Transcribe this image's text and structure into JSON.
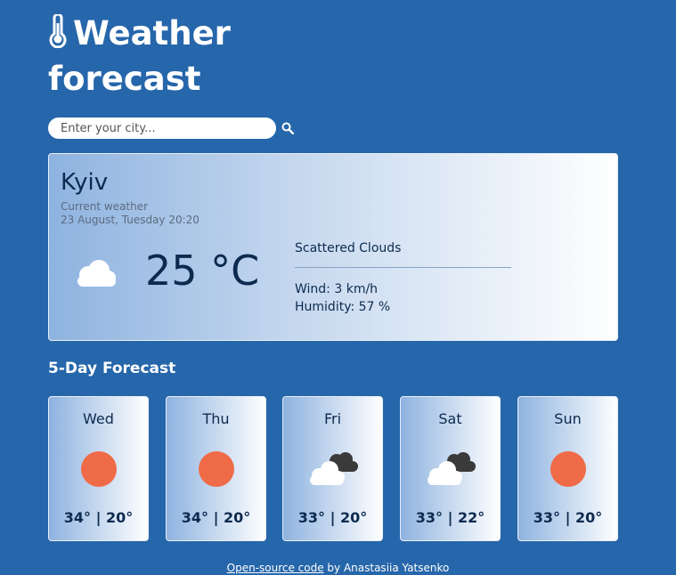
{
  "header": {
    "title": "Weather forecast",
    "icon": "thermometer-icon"
  },
  "search": {
    "placeholder": "Enter your city...",
    "value": "",
    "button_icon": "search-icon"
  },
  "current": {
    "city": "Kyiv",
    "label": "Current weather",
    "datetime": "23 August, Tuesday 20:20",
    "temperature": "25 °C",
    "icon": "cloud-icon",
    "description": "Scattered Clouds",
    "wind": "Wind: 3 km/h",
    "humidity": "Humidity: 57 %"
  },
  "forecast": {
    "title": "5-Day Forecast",
    "days": [
      {
        "day": "Wed",
        "temp": "34° | 20°",
        "icon": "sun-icon"
      },
      {
        "day": "Thu",
        "temp": "34° | 20°",
        "icon": "sun-icon"
      },
      {
        "day": "Fri",
        "temp": "33° | 20°",
        "icon": "cloudy-icon"
      },
      {
        "day": "Sat",
        "temp": "33° | 22°",
        "icon": "cloudy-icon"
      },
      {
        "day": "Sun",
        "temp": "33° | 20°",
        "icon": "sun-icon"
      }
    ]
  },
  "footer": {
    "link_text": "Open-source code",
    "suffix": " by Anastasiia Yatsenko"
  },
  "colors": {
    "background": "#2666aa",
    "sun": "#ef6b47",
    "text_dark": "#0d2a4f"
  }
}
